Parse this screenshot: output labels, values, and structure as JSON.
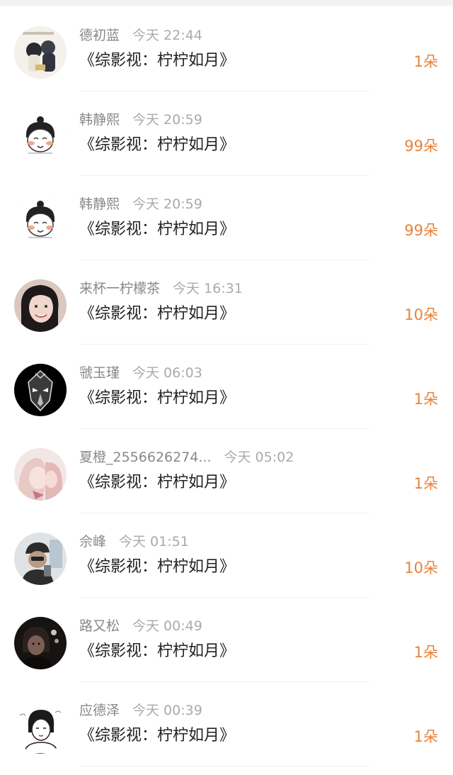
{
  "items": [
    {
      "name": "德初蓝",
      "time": "今天 22:44",
      "title": "《综影视：柠柠如月》",
      "count": "1朵",
      "avatar": "anime-couple-avatar"
    },
    {
      "name": "韩静熙",
      "time": "今天 20:59",
      "title": "《综影视：柠柠如月》",
      "count": "99朵",
      "avatar": "cartoon-girl-avatar"
    },
    {
      "name": "韩静熙",
      "time": "今天 20:59",
      "title": "《综影视：柠柠如月》",
      "count": "99朵",
      "avatar": "cartoon-girl-avatar"
    },
    {
      "name": "来杯一柠檬茶",
      "time": "今天 16:31",
      "title": "《综影视：柠柠如月》",
      "count": "10朵",
      "avatar": "photo-girl-avatar"
    },
    {
      "name": "虢玉瑾",
      "time": "今天 06:03",
      "title": "《综影视：柠柠如月》",
      "count": "1朵",
      "avatar": "dark-mask-avatar"
    },
    {
      "name": "夏橙_2556626274...",
      "time": "今天 05:02",
      "title": "《综影视：柠柠如月》",
      "count": "1朵",
      "avatar": "anime-pink-avatar"
    },
    {
      "name": "佘峰",
      "time": "今天 01:51",
      "title": "《综影视：柠柠如月》",
      "count": "10朵",
      "avatar": "photo-cap-avatar"
    },
    {
      "name": "路又松",
      "time": "今天 00:49",
      "title": "《综影视：柠柠如月》",
      "count": "1朵",
      "avatar": "dark-photo-avatar"
    },
    {
      "name": "应德泽",
      "time": "今天 00:39",
      "title": "《综影视：柠柠如月》",
      "count": "1朵",
      "avatar": "sketch-girl-avatar"
    }
  ],
  "colors": {
    "accent": "#e8833a",
    "name": "#888888",
    "time": "#aaaaaa",
    "title": "#222222"
  }
}
